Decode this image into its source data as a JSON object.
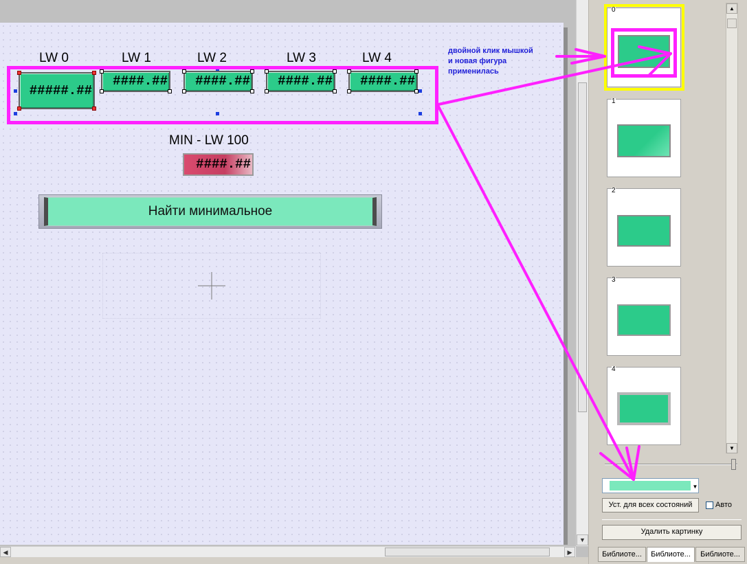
{
  "canvas": {
    "labels": [
      "LW 0",
      "LW 1",
      "LW 2",
      "LW 3",
      "LW 4"
    ],
    "fields": [
      "#####.##",
      "####.##",
      "####.##",
      "####.##",
      "####.##"
    ],
    "min_label": "MIN - LW 100",
    "min_field": "####.##",
    "button_label": "Найти минимальное"
  },
  "annotation": {
    "note_line1": "двойной клик мышкой",
    "note_line2": "и новая фигура",
    "note_line3": "применилась",
    "color": "#ff20ff"
  },
  "panel": {
    "states": [
      "0",
      "1",
      "2",
      "3",
      "4"
    ],
    "set_all_button": "Уст. для всех состояний",
    "auto_checkbox_label": "Авто",
    "delete_button": "Удалить картинку",
    "tabs": [
      "Библиоте...",
      "Библиоте...",
      "Библиоте..."
    ],
    "active_tab": 1,
    "selected_color": "#7be8bc",
    "accent_color": "#2ccb8a"
  }
}
